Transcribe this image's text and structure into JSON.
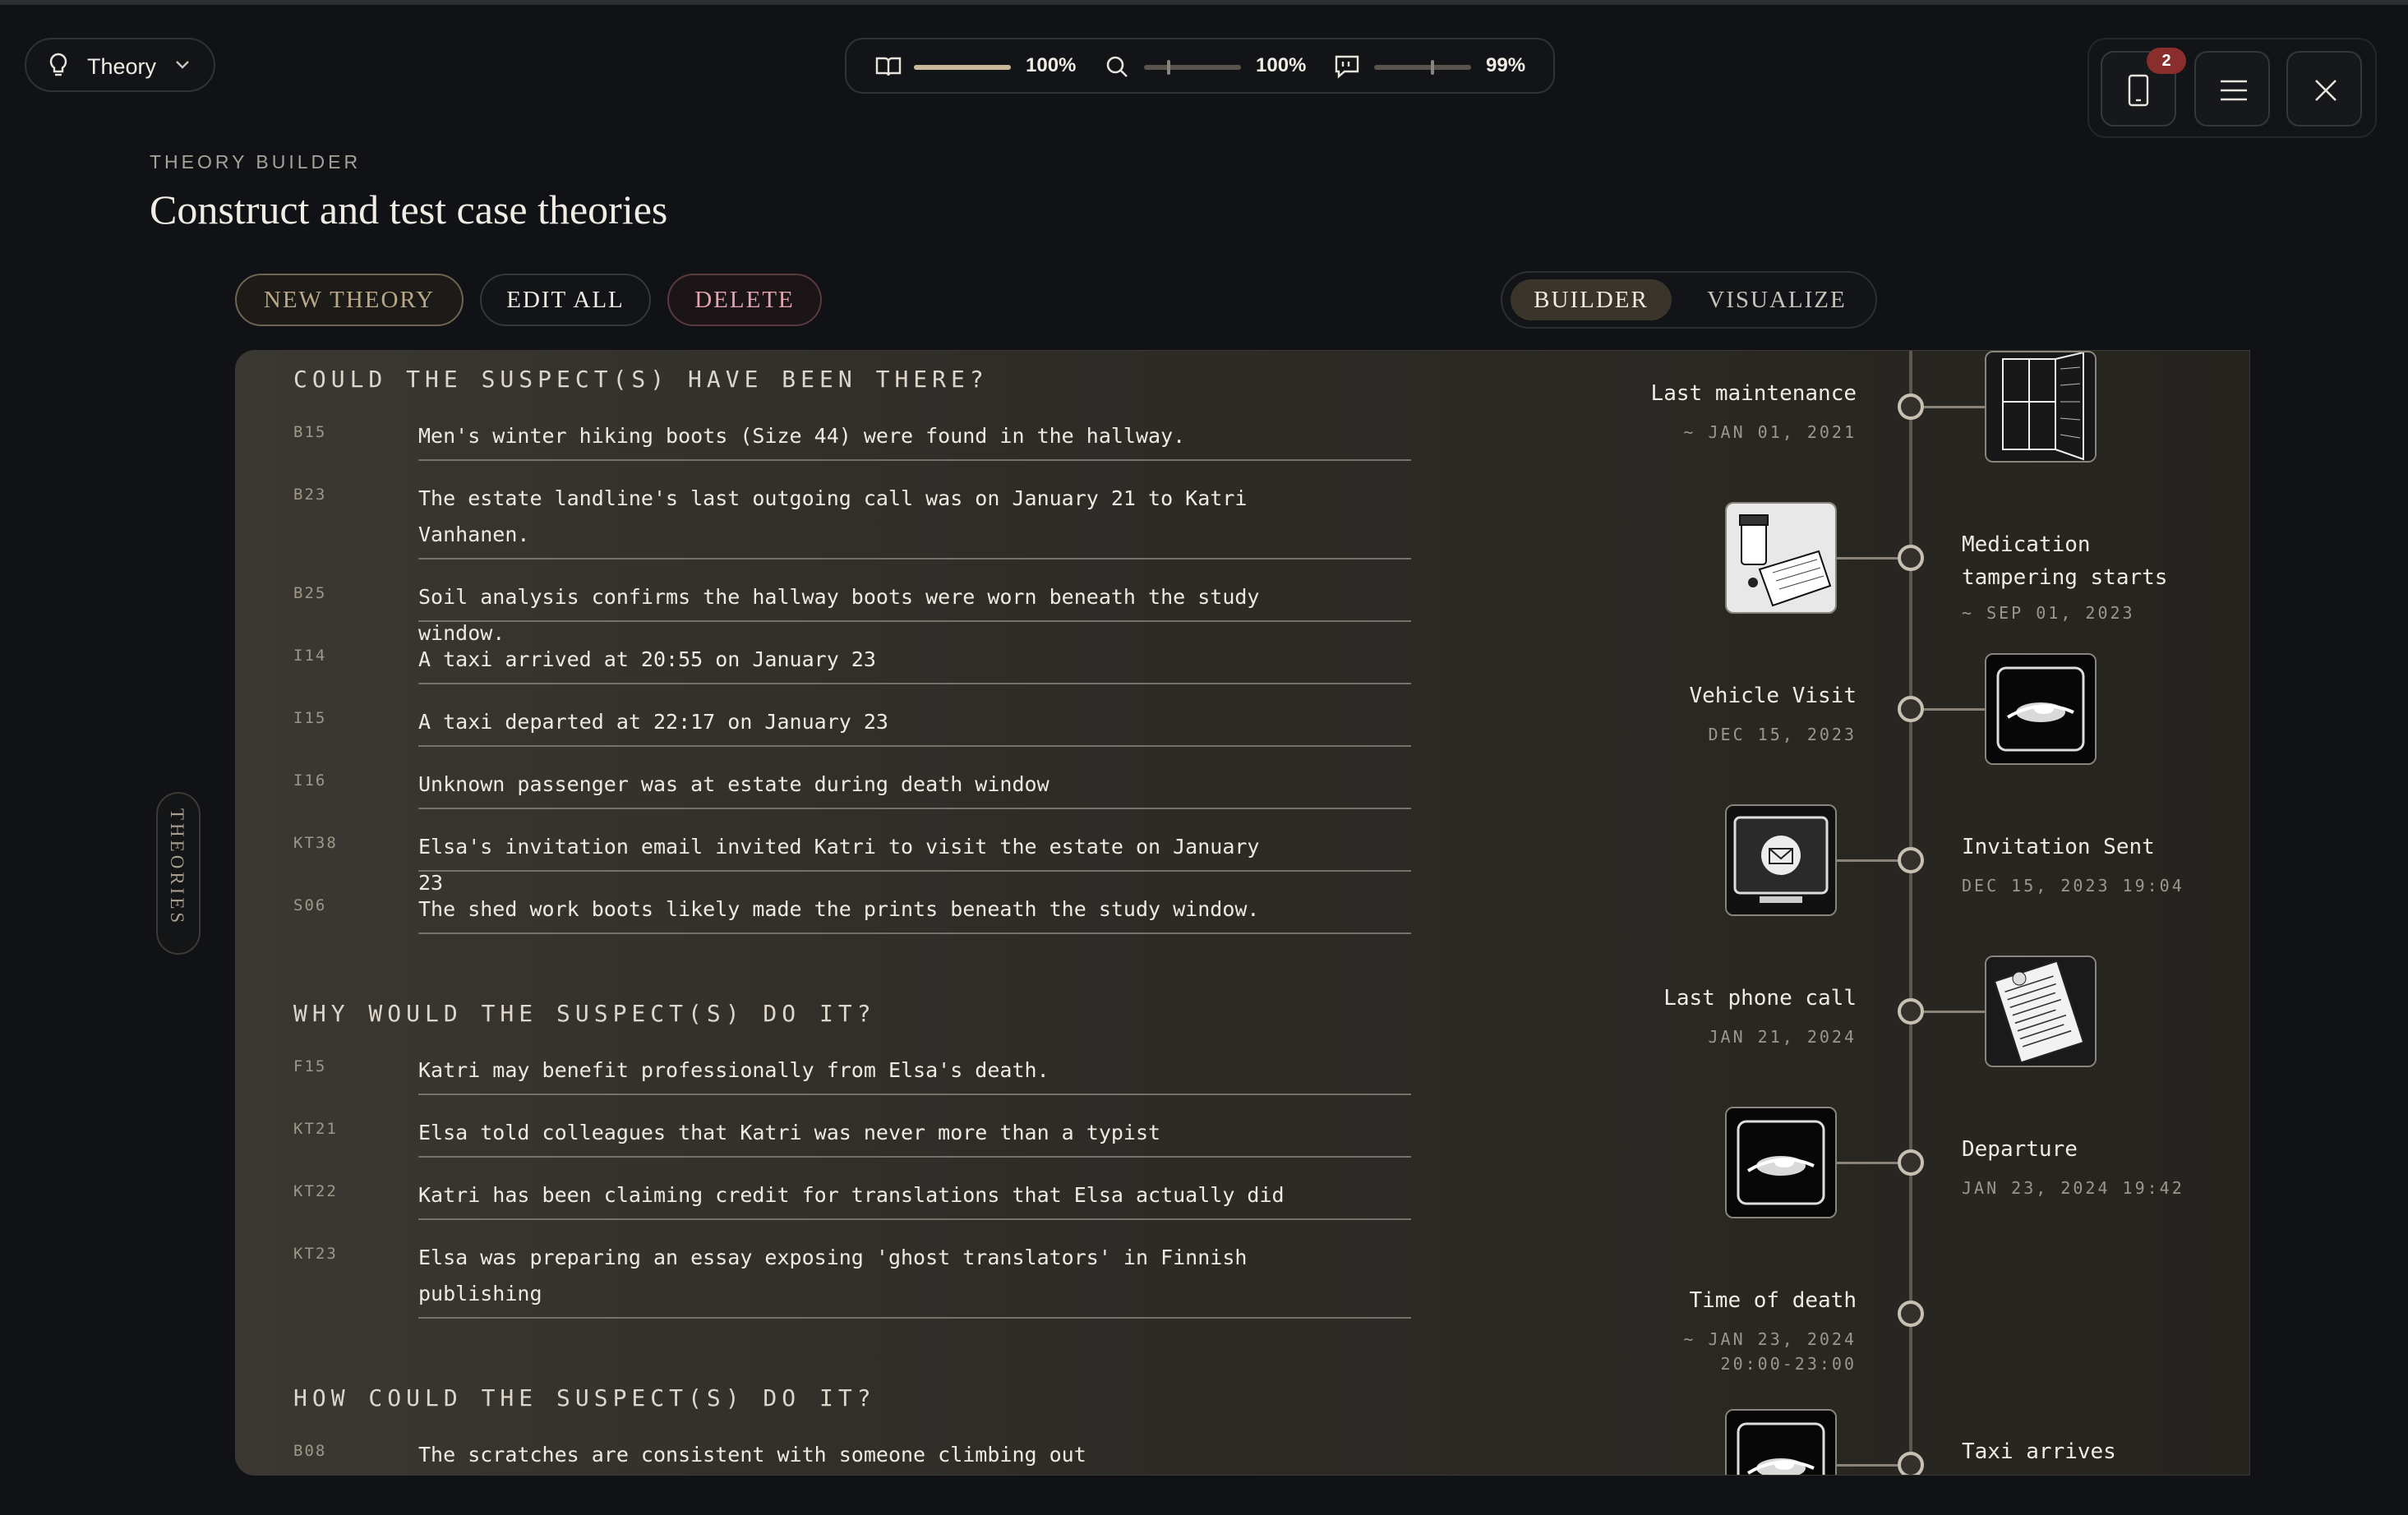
{
  "toolbar": {
    "theory_label": "Theory",
    "zoom_items": [
      {
        "icon": "book-icon",
        "value": "100%",
        "level": 1.0
      },
      {
        "icon": "magnifier-icon",
        "value": "100%",
        "level": 0.25
      },
      {
        "icon": "speech-bubble-icon",
        "value": "99%",
        "level": 0.6
      }
    ],
    "notification_count": "2"
  },
  "header": {
    "kicker": "THEORY BUILDER",
    "title": "Construct and test case theories"
  },
  "actions": {
    "new": "NEW THEORY",
    "edit": "EDIT ALL",
    "delete": "DELETE"
  },
  "view_toggle": {
    "builder": "BUILDER",
    "visualize": "VISUALIZE",
    "active": "builder"
  },
  "side_tab": "THEORIES",
  "sections": [
    {
      "title": "COULD THE SUSPECT(S) HAVE BEEN THERE?",
      "rows": [
        {
          "code": "B15",
          "text": "Men's winter hiking boots (Size 44) were found in the hallway."
        },
        {
          "code": "B23",
          "text": "The estate landline's last outgoing call was on January 21 to Katri Vanhanen."
        },
        {
          "code": "B25",
          "text": "Soil analysis confirms the hallway boots were worn beneath the study window."
        },
        {
          "code": "I14",
          "text": "A taxi arrived at 20:55 on January 23"
        },
        {
          "code": "I15",
          "text": "A taxi departed at 22:17 on January 23"
        },
        {
          "code": "I16",
          "text": "Unknown passenger was at estate during death window"
        },
        {
          "code": "KT38",
          "text": "Elsa's invitation email invited Katri to visit the estate on January 23"
        },
        {
          "code": "S06",
          "text": "The shed work boots likely made the prints beneath the study window."
        }
      ]
    },
    {
      "title": "WHY WOULD THE SUSPECT(S) DO IT?",
      "rows": [
        {
          "code": "F15",
          "text": "Katri may benefit professionally from Elsa's death."
        },
        {
          "code": "KT21",
          "text": "Elsa told colleagues that Katri was never more than a typist"
        },
        {
          "code": "KT22",
          "text": "Katri has been claiming credit for translations that Elsa actually did"
        },
        {
          "code": "KT23",
          "text": "Elsa was preparing an essay exposing 'ghost translators' in Finnish publishing"
        }
      ]
    },
    {
      "title": "HOW COULD THE SUSPECT(S) DO IT?",
      "rows": [
        {
          "code": "B08",
          "text": "The scratches are consistent with someone climbing out"
        }
      ]
    }
  ],
  "timeline": [
    {
      "label": "Last maintenance",
      "date": "~ JAN 01, 2021",
      "image": "window-frame-sketch",
      "side": "left"
    },
    {
      "label": "Medication tampering starts",
      "date": "~ SEP 01, 2023",
      "image": "pill-bottles-sketch",
      "side": "right"
    },
    {
      "label": "Vehicle Visit",
      "date": "DEC 15, 2023",
      "image": "car-headlights-sketch",
      "side": "left"
    },
    {
      "label": "Invitation Sent",
      "date": "DEC 15, 2023 19:04",
      "image": "email-monitor-sketch",
      "side": "right"
    },
    {
      "label": "Last phone call",
      "date": "JAN 21, 2024",
      "image": "phone-records-sketch",
      "side": "left"
    },
    {
      "label": "Departure",
      "date": "JAN 23, 2024 19:42",
      "image": "car-headlights-sketch",
      "side": "right"
    },
    {
      "label": "Time of death",
      "date": "~ JAN 23, 2024 20:00-23:00",
      "image": "",
      "side": "left"
    },
    {
      "label": "Taxi arrives",
      "date": "",
      "image": "car-headlights-sketch",
      "side": "right"
    }
  ]
}
